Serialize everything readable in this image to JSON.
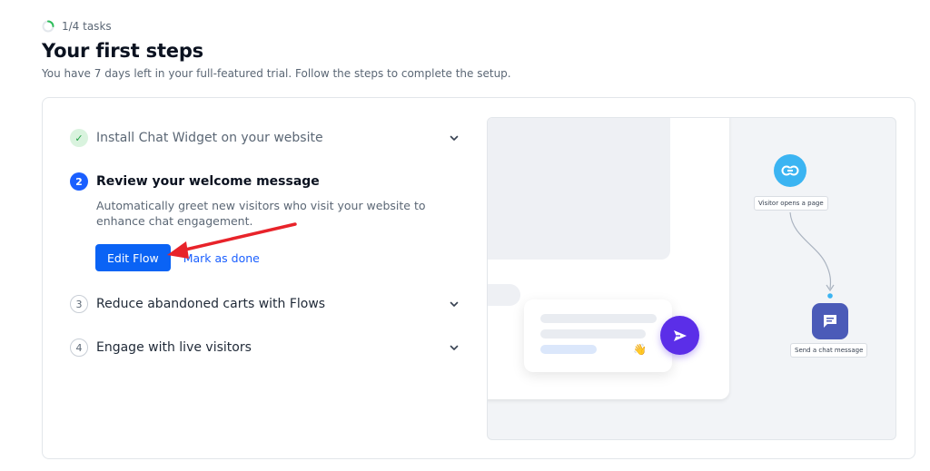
{
  "progress": {
    "text": "1/4 tasks",
    "fraction": 0.25
  },
  "header": {
    "title": "Your first steps",
    "subtitle": "You have 7 days left in your full-featured trial. Follow the steps to complete the setup."
  },
  "steps": [
    {
      "badge": "✓",
      "title": "Install Chat Widget on your website",
      "state": "done"
    },
    {
      "badge": "2",
      "title": "Review your welcome message",
      "state": "active",
      "description": "Automatically greet new visitors who visit your website to enhance chat engagement.",
      "primary_action": "Edit Flow",
      "secondary_action": "Mark as done"
    },
    {
      "badge": "3",
      "title": "Reduce abandoned carts with Flows",
      "state": "pending"
    },
    {
      "badge": "4",
      "title": "Engage with live visitors",
      "state": "pending"
    }
  ],
  "illustration": {
    "trigger_label": "Visitor opens a page",
    "action_label": "Send a chat message",
    "wave_emoji": "👋"
  },
  "colors": {
    "primary": "#0a63f5",
    "done_green": "#21a045",
    "send_purple": "#5b2ee8",
    "trigger_blue": "#3bb4f2",
    "action_indigo": "#4b5bb8",
    "annotation_red": "#e8232a"
  }
}
